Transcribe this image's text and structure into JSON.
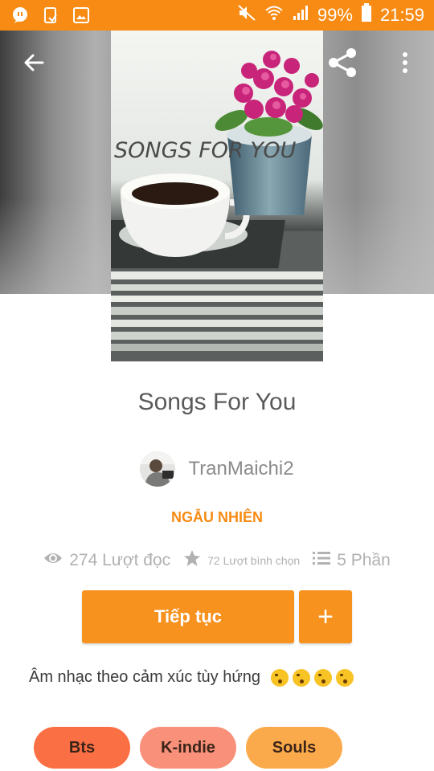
{
  "status_bar": {
    "battery": "99%",
    "time": "21:59"
  },
  "header": {
    "cover_text": "SONGS FOR YOU"
  },
  "story": {
    "title": "Songs For You",
    "author": "TranMaichi2",
    "category": "NGẪU NHIÊN",
    "stats": {
      "reads": "274 Lượt đọc",
      "votes": "72 Lượt bình chọn",
      "parts": "5 Phần"
    },
    "description": "Âm nhạc theo cảm xúc tùy hứng"
  },
  "actions": {
    "continue_label": "Tiếp tục",
    "add_label": "+"
  },
  "tags": [
    "Bts",
    "K-indie",
    "Souls"
  ],
  "colors": {
    "accent": "#f78b14",
    "tag_1": "#fb6f44",
    "tag_2": "#f9907a",
    "tag_3": "#fbaa4b"
  },
  "icons": [
    "chat-notification-icon",
    "phone-icon",
    "image-icon",
    "mute-icon",
    "wifi-icon",
    "signal-icon",
    "battery-icon",
    "back-arrow-icon",
    "share-icon",
    "more-vert-icon",
    "eye-icon",
    "star-icon",
    "list-icon"
  ]
}
